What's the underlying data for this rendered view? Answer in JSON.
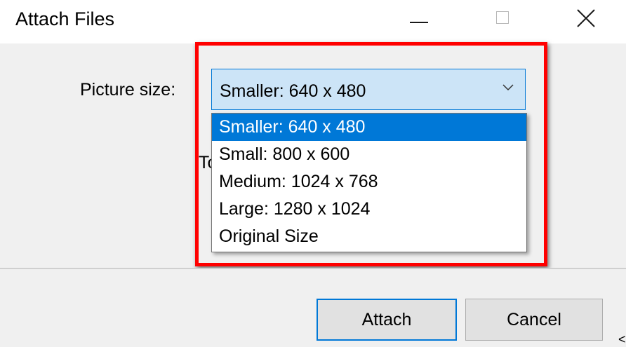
{
  "window": {
    "title": "Attach Files"
  },
  "form": {
    "picture_size_label": "Picture size:",
    "picture_size_value": "Smaller: 640 x 480",
    "obscured_text_fragment": "To"
  },
  "dropdown": {
    "options": [
      {
        "label": "Smaller: 640 x 480",
        "selected": true
      },
      {
        "label": "Small: 800 x 600",
        "selected": false
      },
      {
        "label": "Medium: 1024 x 768",
        "selected": false
      },
      {
        "label": "Large: 1280 x 1024",
        "selected": false
      },
      {
        "label": "Original Size",
        "selected": false
      }
    ]
  },
  "buttons": {
    "attach_label": "Attach",
    "cancel_label": "Cancel"
  },
  "misc": {
    "corner_glyph": "<"
  },
  "colors": {
    "accent": "#0078d7",
    "highlight": "#ff0000",
    "select_bg": "#cce4f7",
    "dialog_bg": "#f0f0f0"
  },
  "icons": {
    "minimize": "minimize-icon",
    "maximize": "maximize-icon",
    "close": "close-icon",
    "dropdown": "chevron-down-icon"
  }
}
